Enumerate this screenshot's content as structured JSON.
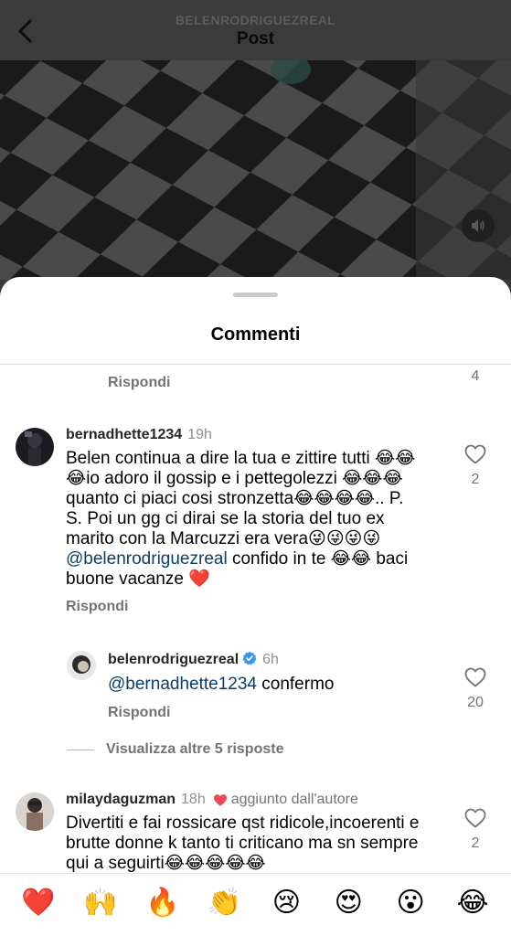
{
  "header": {
    "username": "BELENRODRIGUEZREAL",
    "title": "Post"
  },
  "sheet": {
    "title": "Commenti"
  },
  "previous_comment": {
    "reply_label": "Rispondi",
    "likes": "4"
  },
  "comment1": {
    "username": "bernadhette1234",
    "time": "19h",
    "text_lines": [
      "Belen continua a dire la tua e zittire tutti 😂😂",
      "😂io adoro il gossip e i pettegolezzi 😂😂😂",
      "quanto ci piaci cosi stronzetta😂😂😂😂.. P.",
      "S. Poi un gg ci dirai se la storia del tuo ex",
      "marito con la Marcuzzi era vera😜😜😜😜"
    ],
    "mention": "@belenrodriguezreal",
    "text_after_mention": " confido in te 😂😂 baci",
    "text_last": "buone vacanze ❤️",
    "reply_label": "Rispondi",
    "likes": "2"
  },
  "reply1": {
    "username": "belenrodriguezreal",
    "time": "6h",
    "mention": "@bernadhette1234",
    "text": " confermo",
    "reply_label": "Rispondi",
    "likes": "20"
  },
  "view_more": {
    "label": "Visualizza altre 5 risposte"
  },
  "comment2": {
    "username": "milaydaguzman",
    "time": "18h",
    "badge": "aggiunto dall'autore",
    "text_lines": [
      "Divertiti e fai rossicare qst ridicole,incoerenti e",
      "brutte donne k tanto ti criticano ma sn sempre",
      "qui a seguirti😂😂😂😂😂"
    ],
    "likes": "2"
  },
  "emoji_bar": [
    "❤️",
    "🙌",
    "🔥",
    "👏",
    "😢",
    "😍",
    "😮",
    "😂"
  ],
  "colors": {
    "mention": "#0b3d6b",
    "verified": "#3797f0",
    "heart_red": "#ed4956",
    "secondary_text": "#737373"
  }
}
